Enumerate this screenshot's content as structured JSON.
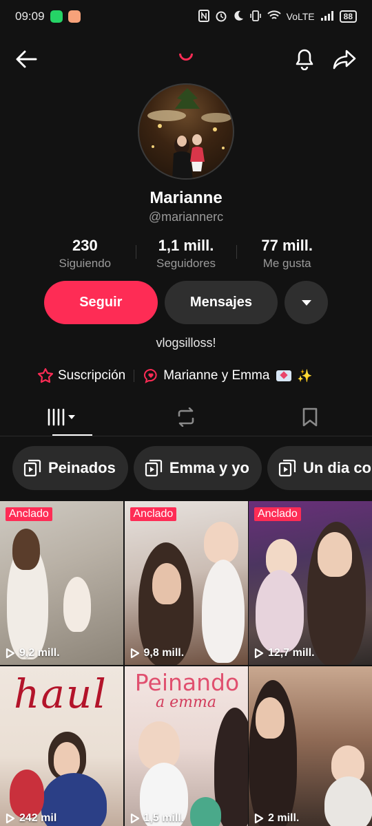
{
  "status_bar": {
    "time": "09:09",
    "network": "VoLTE",
    "battery": "88",
    "icons": [
      "whatsapp-icon",
      "app-icon",
      "nfc-icon",
      "alarm-icon",
      "moon-icon",
      "vibrate-icon",
      "wifi-icon",
      "signal-icon",
      "battery-icon"
    ]
  },
  "top_nav": {
    "icons": [
      "back-arrow-icon",
      "bell-icon",
      "share-icon"
    ]
  },
  "profile": {
    "display_name": "Marianne",
    "username": "@mariannerc",
    "stats": [
      {
        "value": "230",
        "label": "Siguiendo"
      },
      {
        "value": "1,1 mill.",
        "label": "Seguidores"
      },
      {
        "value": "77 mill.",
        "label": "Me gusta"
      }
    ],
    "follow_label": "Seguir",
    "message_label": "Mensajes",
    "bio": "vlogsilloss!",
    "links": [
      {
        "label": "Suscripción",
        "icon": "subscription-star-icon"
      },
      {
        "label": "Marianne y Emma",
        "icon": "heart-chat-icon"
      }
    ]
  },
  "tabs": [
    {
      "name": "videos",
      "icon": "videos-grid-icon",
      "active": true
    },
    {
      "name": "reposts",
      "icon": "repost-icon",
      "active": false
    },
    {
      "name": "saved",
      "icon": "bookmark-icon",
      "active": false
    }
  ],
  "playlists": [
    "Peinados",
    "Emma y yo",
    "Un dia conm"
  ],
  "videos": [
    {
      "pinned_label": "Anclado",
      "views": "9,2 mill."
    },
    {
      "pinned_label": "Anclado",
      "views": "9,8 mill."
    },
    {
      "pinned_label": "Anclado",
      "views": "12,7 mill."
    },
    {
      "overlay_text": "haul",
      "views": "242 mil"
    },
    {
      "overlay_text": "Peinando",
      "overlay_sub": "a emma",
      "views": "1,5 mill."
    },
    {
      "views": "2 mill."
    }
  ],
  "colors": {
    "accent": "#fe2c55",
    "background": "#121212",
    "button_dark": "#2f2f2f",
    "muted_text": "#9a9a9a"
  }
}
